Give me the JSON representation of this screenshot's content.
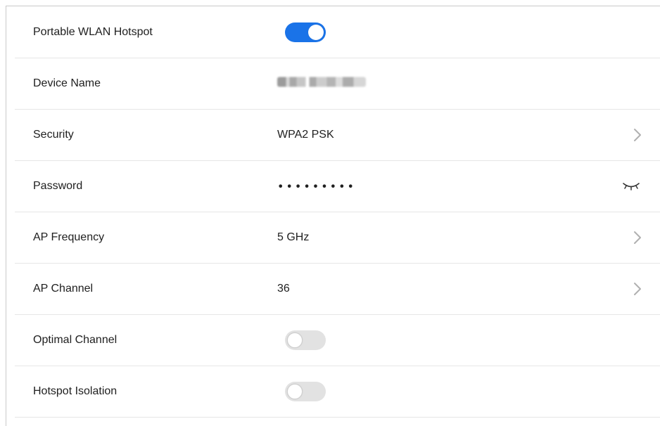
{
  "colors": {
    "accent": "#1a73e8",
    "toggle_off": "#e2e2e2",
    "divider": "#e6e6e6",
    "chevron": "#b0b0b0"
  },
  "settings": [
    {
      "label": "Portable WLAN Hotspot",
      "control": "toggle",
      "enabled": true
    },
    {
      "label": "Device Name",
      "control": "blurred-text"
    },
    {
      "label": "Security",
      "value": "WPA2 PSK",
      "control": "chevron-right-icon"
    },
    {
      "label": "Password",
      "value": "•••••••••",
      "control": "eye-closed-icon"
    },
    {
      "label": "AP Frequency",
      "value": "5 GHz",
      "control": "chevron-right-icon"
    },
    {
      "label": "AP Channel",
      "value": "36",
      "control": "chevron-right-icon"
    },
    {
      "label": "Optimal Channel",
      "control": "toggle",
      "enabled": false
    },
    {
      "label": "Hotspot Isolation",
      "control": "toggle",
      "enabled": false
    }
  ]
}
